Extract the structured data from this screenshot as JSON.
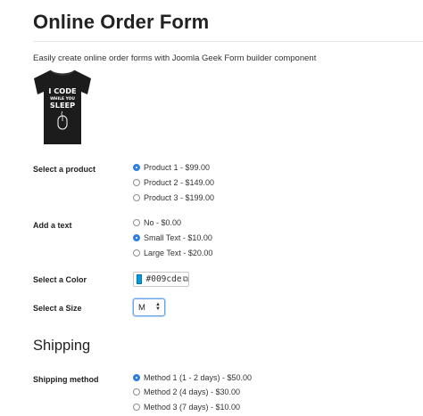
{
  "page": {
    "title": "Online Order Form",
    "intro": "Easily create online order forms with Joomla Geek Form builder component"
  },
  "product_image": {
    "text_lines": [
      "I CODE",
      "WHILE YOU",
      "SLEEP"
    ]
  },
  "fields": {
    "product": {
      "label": "Select a product",
      "options": [
        "Product 1 - $99.00",
        "Product 2 - $149.00",
        "Product 3 - $199.00"
      ],
      "selected": 0
    },
    "text": {
      "label": "Add a text",
      "options": [
        "No - $0.00",
        "Small Text - $10.00",
        "Large Text - $20.00"
      ],
      "selected": 1
    },
    "color": {
      "label": "Select a Color",
      "value": "#009cde",
      "swatch": "#009cde"
    },
    "size": {
      "label": "Select a Size",
      "value": "M"
    }
  },
  "shipping": {
    "heading": "Shipping",
    "label": "Shipping method",
    "options": [
      "Method 1 (1 - 2 days) - $50.00",
      "Method 2 (4 days) - $30.00",
      "Method 3 (7 days) - $10.00"
    ],
    "selected": 0
  },
  "colors": {
    "radio_selected": "#2f7fe0"
  }
}
